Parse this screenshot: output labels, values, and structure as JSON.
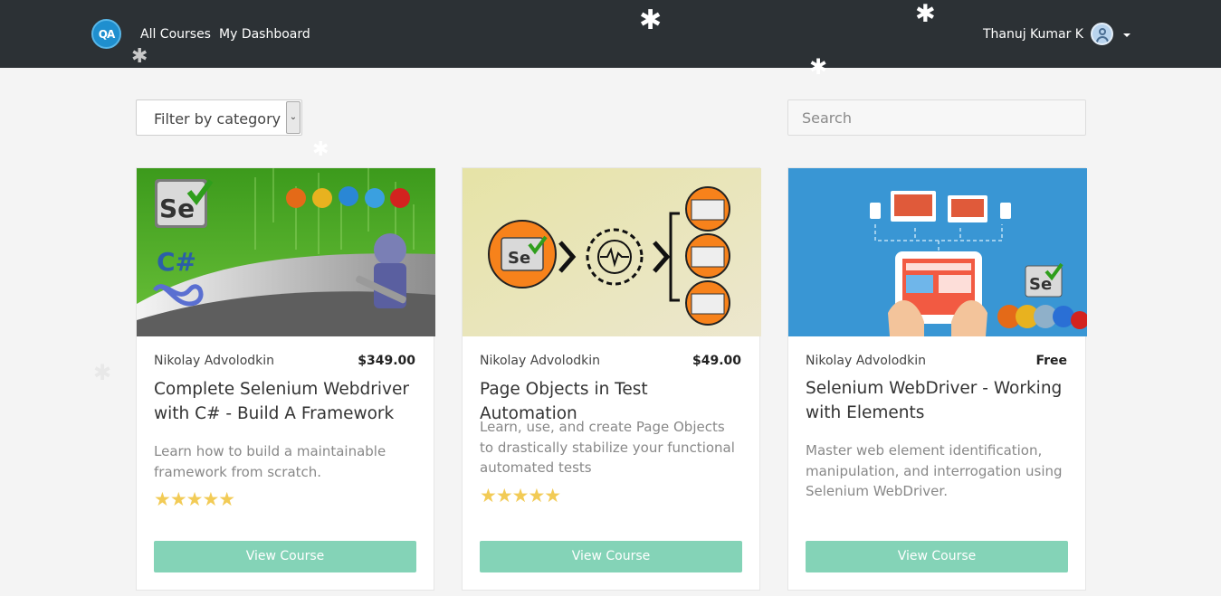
{
  "header": {
    "logo_text": "QA",
    "nav": [
      "All Courses",
      "My Dashboard"
    ],
    "user_name": "Thanuj Kumar K"
  },
  "filters": {
    "category_label": "Filter by category",
    "search_placeholder": "Search"
  },
  "courses": [
    {
      "author": "Nikolay Advolodkin",
      "price": "$349.00",
      "title": "Complete Selenium Webdriver with C# - Build A Framework",
      "description": "Learn how to build a maintainable framework from scratch.",
      "rating": 5,
      "button_label": "View Course",
      "image_text": [
        "Se",
        "C#"
      ],
      "accent_color": "#5cac2c"
    },
    {
      "author": "Nikolay Advolodkin",
      "price": "$49.00",
      "title": "Page Objects in Test Automation",
      "description": "Learn, use, and create Page Objects to drastically stabilize your functional automated tests",
      "rating": 5,
      "button_label": "View Course",
      "image_text": [
        "Se"
      ],
      "accent_color": "#f7821b"
    },
    {
      "author": "Nikolay Advolodkin",
      "price": "Free",
      "title": "Selenium WebDriver - Working with Elements",
      "description": "Master web element identification, manipulation, and interrogation using Selenium WebDriver.",
      "rating": null,
      "button_label": "View Course",
      "image_text": [
        "Se"
      ],
      "accent_color": "#3996d4"
    }
  ],
  "colors": {
    "header_bg": "#2c3135",
    "button_bg": "#84d3b7",
    "star": "#f2cb56"
  }
}
